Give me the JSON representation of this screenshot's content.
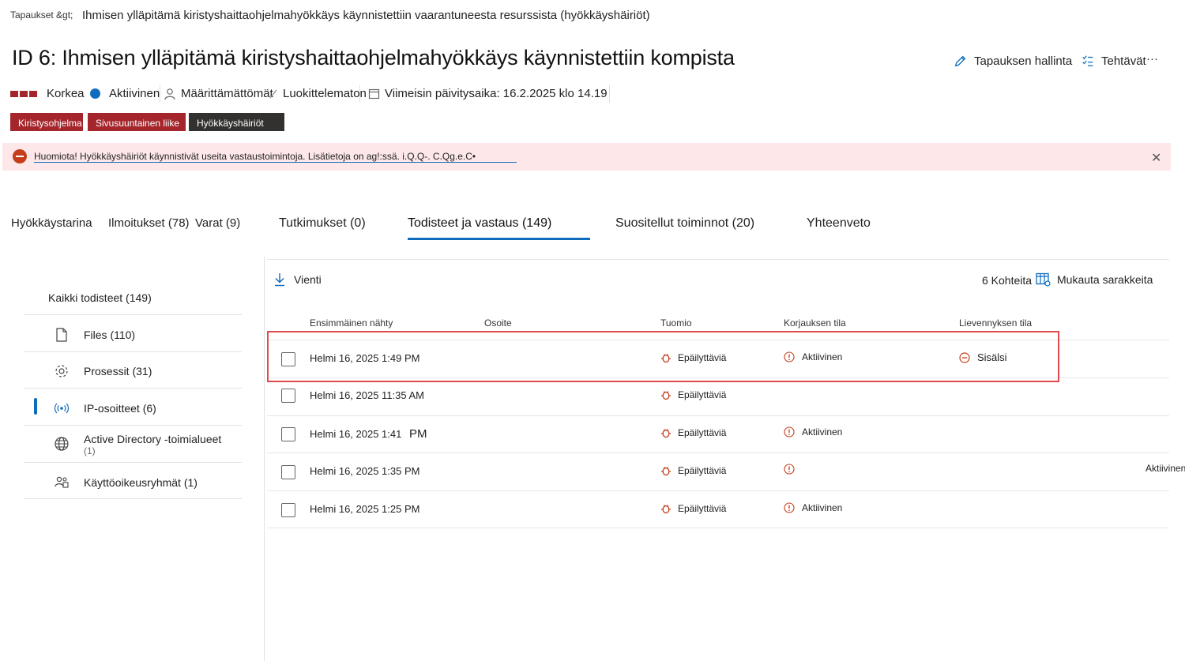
{
  "breadcrumb": {
    "root": "Tapaukset &gt;",
    "current": "Ihmisen ylläpitämä kiristyshaittaohjelmahyökkäys käynnistettiin vaarantuneesta resurssista (hyökkäyshäiriöt)"
  },
  "incident": {
    "title": "ID 6: Ihmisen ylläpitämä kiristyshaittaohjelmahyökkäys käynnistettiin kompista",
    "manage_label": "Tapauksen hallinta",
    "tasks_label": "Tehtävät",
    "more_label": "···",
    "severity": "Korkea",
    "status": "Aktiivinen",
    "assignee": "Määrittämättömät",
    "classification": "Luokittelematon",
    "last_updated": "Viimeisin päivitysaika: 16.2.2025 klo 14.19",
    "tags": [
      "Kiristysohjelma",
      "Sivusuuntainen liike",
      "Hyökkäyshäiriöt"
    ],
    "colors": {
      "severity": "#a4262c",
      "status": "#0f6cbd",
      "tag_red": "#a4262c",
      "tag_dark": "#323130"
    }
  },
  "banner": {
    "text": "Huomiota! Hyökkäyshäiriöt käynnistivät useita vastaustoimintoja. Lisätietoja on ag!:ssä. i.Q.Q-. C.Qg.e.C•",
    "close_icon": "close-icon"
  },
  "tabs": [
    {
      "label": "Hyökkäystarina"
    },
    {
      "label": "Ilmoitukset (78)"
    },
    {
      "label": "Varat (9)"
    },
    {
      "label": "Tutkimukset (0)"
    },
    {
      "label": "Todisteet ja vastaus (149)"
    },
    {
      "label": "Suositellut toiminnot (20)"
    },
    {
      "label": "Yhteenveto"
    }
  ],
  "evidence_nav": {
    "all": "Kaikki todisteet (149)",
    "items": [
      {
        "label": "Files (110)",
        "icon": "file-icon"
      },
      {
        "label": "Prosessit (31)",
        "icon": "gear-icon"
      },
      {
        "label": "IP-osoitteet (6)",
        "icon": "broadcast-icon"
      },
      {
        "label": "Active Directory -toimialueet",
        "sub": "(1)",
        "icon": "globe-icon"
      },
      {
        "label": "Käyttöoikeusryhmät (1)",
        "icon": "user-group-icon"
      }
    ]
  },
  "toolbar": {
    "export": "Vienti",
    "count": "6 Kohteita",
    "customize": "Mukauta sarakkeita"
  },
  "table": {
    "headers": [
      "Ensimmäinen nähty",
      "Osoite",
      "Tuomio",
      "Korjauksen tila",
      "Lievennyksen tila"
    ],
    "rows": [
      {
        "first_seen": "Helmi 16, 2025 1:49 PM",
        "address": "",
        "verdict": "Epäilyttäviä",
        "remediation": "Aktiivinen",
        "mitigation": "Sisälsi"
      },
      {
        "first_seen": "Helmi 16, 2025 11:35 AM",
        "address": "",
        "verdict": "Epäilyttäviä",
        "remediation": "",
        "mitigation": ""
      },
      {
        "first_seen": "Helmi 16, 2025 1:41",
        "first_seen_suffix": "PM",
        "address": "",
        "verdict": "Epäilyttäviä",
        "remediation": "Aktiivinen",
        "mitigation": ""
      },
      {
        "first_seen": "Helmi 16, 2025 1:35 PM",
        "address": "",
        "verdict": "Epäilyttäviä",
        "remediation": "",
        "remediation_overflow": "Aktiivinen",
        "mitigation": ""
      },
      {
        "first_seen": "Helmi 16, 2025 1:25 PM",
        "address": "",
        "verdict": "Epäilyttäviä",
        "remediation": "Aktiivinen",
        "mitigation": ""
      }
    ]
  }
}
